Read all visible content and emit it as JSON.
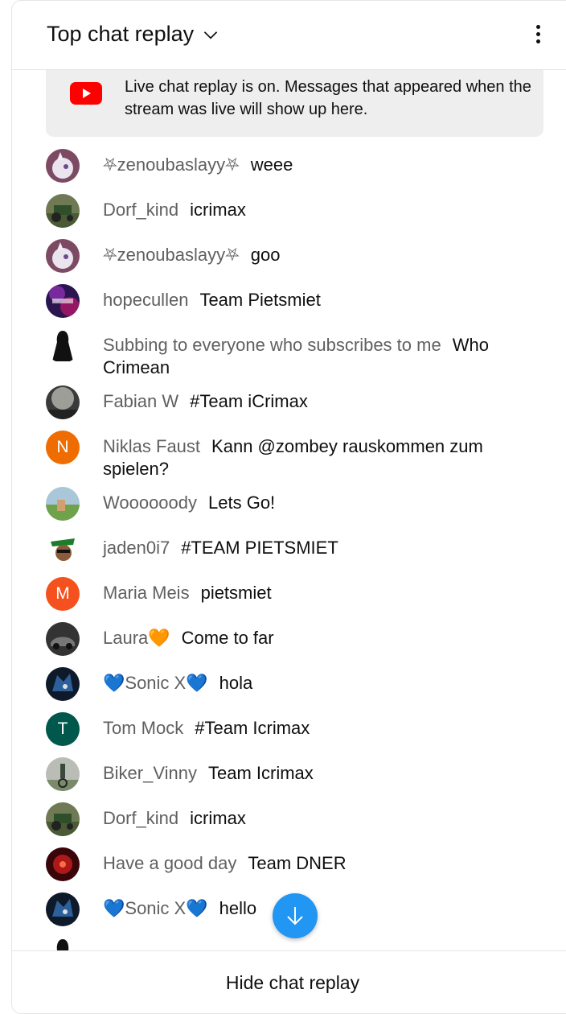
{
  "header": {
    "title": "Top chat replay"
  },
  "banner": {
    "text": "Live chat replay is on. Messages that appeared when the stream was live will show up here."
  },
  "messages": [
    {
      "author": "⛧zenoubaslayy⛧",
      "text": "weee",
      "avatar": "pony-avatar"
    },
    {
      "author": "Dorf_kind",
      "text": "icrimax",
      "avatar": "tractor-avatar"
    },
    {
      "author": "⛧zenoubaslayy⛧",
      "text": "goo",
      "avatar": "pony-avatar"
    },
    {
      "author": "hopecullen",
      "text": "Team Pietsmiet",
      "avatar": "galaxy-avatar"
    },
    {
      "author": "Subbing to everyone who subscribes to me",
      "text": "Who Crimean",
      "avatar": "dark-figure-avatar"
    },
    {
      "author": "Fabian W",
      "text": "#Team iCrimax",
      "avatar": "fog-avatar"
    },
    {
      "author": "Niklas Faust",
      "text": "Kann @zombey rauskommen zum spielen?",
      "avatar_letter": "N",
      "avatar_color": "#ef6c00"
    },
    {
      "author": "Woooooody",
      "text": "Lets Go!",
      "avatar": "field-avatar"
    },
    {
      "author": "jaden0i7",
      "text": "#TEAM PIETSMIET",
      "avatar": "cartoon-avatar"
    },
    {
      "author": "Maria Meis",
      "text": "pietsmiet",
      "avatar_letter": "M",
      "avatar_color": "#f4511e"
    },
    {
      "author": "Laura🧡",
      "text": "Come to far",
      "avatar": "car-avatar"
    },
    {
      "author": "💙Sonic X💙",
      "text": "hola",
      "avatar": "sonic-avatar"
    },
    {
      "author": "Tom Mock",
      "text": "#Team Icrimax",
      "avatar_letter": "T",
      "avatar_color": "#00574b"
    },
    {
      "author": "Biker_Vinny",
      "text": "Team Icrimax",
      "avatar": "biker-avatar"
    },
    {
      "author": "Dorf_kind",
      "text": "icrimax",
      "avatar": "tractor-avatar"
    },
    {
      "author": "Have a good day",
      "text": "Team DNER",
      "avatar": "fireworks-avatar"
    },
    {
      "author": "💙Sonic X💙",
      "text": "hello",
      "avatar": "sonic-avatar"
    }
  ],
  "footer": {
    "hide_label": "Hide chat replay"
  }
}
